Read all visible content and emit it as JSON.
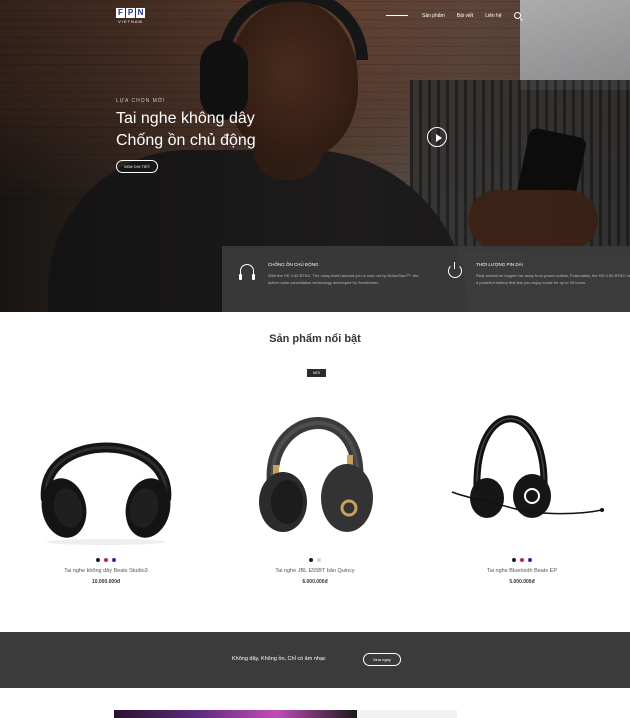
{
  "nav": {
    "logo_letters": [
      "F",
      "P",
      "N"
    ],
    "logo_sub": "VIETNAM",
    "items": [
      {
        "label": "Sản phẩm"
      },
      {
        "label": "Bài viết"
      },
      {
        "label": "Liên hệ"
      }
    ],
    "search_icon": "search-icon"
  },
  "hero": {
    "kicker": "LỰA CHỌN MỚI",
    "title_line1": "Tai nghe không dây",
    "title_line2": "Chống ồn chủ động",
    "button_label": "XEM CHI TIẾT",
    "play_icon": "play-icon"
  },
  "features": [
    {
      "icon": "headset-icon",
      "title": "CHỐNG ỒN CHỦ ĐỘNG",
      "desc": "With the HD 4.50 BTNC. The noisy world around you is shut out by NoiseGard™, the active noise cancellation technology developed by Sennheiser."
    },
    {
      "icon": "power-icon",
      "title": "THỜI LƯỢNG PIN DÀI",
      "desc": "Real adventure happen far away from power outlets. Fortunately, the HD 4.50 BTNC has a powerful battery that lets you enjoy music for up to 25 hours."
    }
  ],
  "products_section": {
    "title": "Sản phẩm nổi bật",
    "badge": "MỚI",
    "items": [
      {
        "name": "Tai nghe không dây Beats Studio3",
        "price": "10.000.000đ",
        "colors": [
          "#1a1a1a",
          "#c0282d",
          "#1e3c8c"
        ]
      },
      {
        "name": "Tai nghe JBL E55BT bản Quincy",
        "price": "6.000.000đ",
        "colors": [
          "#1a1a1a",
          "#e8cfc8"
        ]
      },
      {
        "name": "Tai nghe Bluetooth Beats EP",
        "price": "5.000.000đ",
        "colors": [
          "#1a1a1a",
          "#c0282d",
          "#1e3c8c"
        ]
      }
    ]
  },
  "cta": {
    "text": "Không dây, Không ồn, Chỉ có âm nhạc",
    "button_label": "Mua ngay"
  }
}
